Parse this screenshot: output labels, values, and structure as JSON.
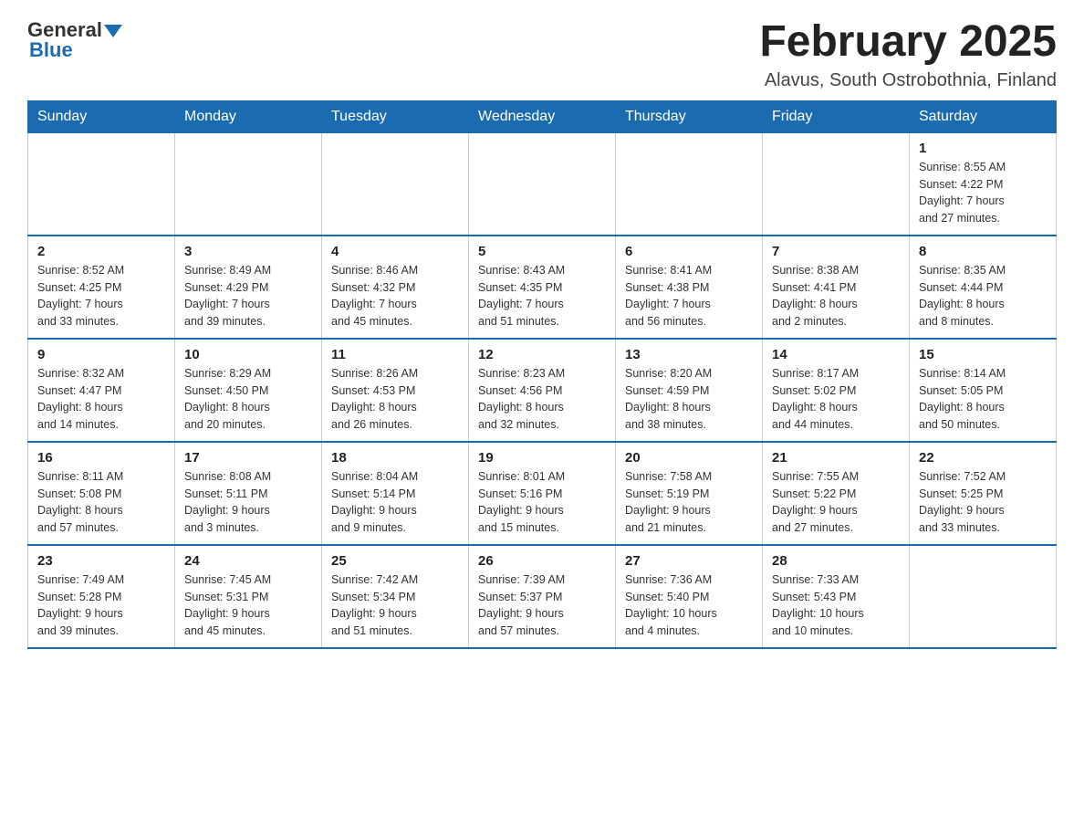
{
  "logo": {
    "text_general": "General",
    "text_blue": "Blue"
  },
  "title": "February 2025",
  "subtitle": "Alavus, South Ostrobothnia, Finland",
  "weekdays": [
    "Sunday",
    "Monday",
    "Tuesday",
    "Wednesday",
    "Thursday",
    "Friday",
    "Saturday"
  ],
  "weeks": [
    [
      {
        "day": "",
        "info": ""
      },
      {
        "day": "",
        "info": ""
      },
      {
        "day": "",
        "info": ""
      },
      {
        "day": "",
        "info": ""
      },
      {
        "day": "",
        "info": ""
      },
      {
        "day": "",
        "info": ""
      },
      {
        "day": "1",
        "info": "Sunrise: 8:55 AM\nSunset: 4:22 PM\nDaylight: 7 hours\nand 27 minutes."
      }
    ],
    [
      {
        "day": "2",
        "info": "Sunrise: 8:52 AM\nSunset: 4:25 PM\nDaylight: 7 hours\nand 33 minutes."
      },
      {
        "day": "3",
        "info": "Sunrise: 8:49 AM\nSunset: 4:29 PM\nDaylight: 7 hours\nand 39 minutes."
      },
      {
        "day": "4",
        "info": "Sunrise: 8:46 AM\nSunset: 4:32 PM\nDaylight: 7 hours\nand 45 minutes."
      },
      {
        "day": "5",
        "info": "Sunrise: 8:43 AM\nSunset: 4:35 PM\nDaylight: 7 hours\nand 51 minutes."
      },
      {
        "day": "6",
        "info": "Sunrise: 8:41 AM\nSunset: 4:38 PM\nDaylight: 7 hours\nand 56 minutes."
      },
      {
        "day": "7",
        "info": "Sunrise: 8:38 AM\nSunset: 4:41 PM\nDaylight: 8 hours\nand 2 minutes."
      },
      {
        "day": "8",
        "info": "Sunrise: 8:35 AM\nSunset: 4:44 PM\nDaylight: 8 hours\nand 8 minutes."
      }
    ],
    [
      {
        "day": "9",
        "info": "Sunrise: 8:32 AM\nSunset: 4:47 PM\nDaylight: 8 hours\nand 14 minutes."
      },
      {
        "day": "10",
        "info": "Sunrise: 8:29 AM\nSunset: 4:50 PM\nDaylight: 8 hours\nand 20 minutes."
      },
      {
        "day": "11",
        "info": "Sunrise: 8:26 AM\nSunset: 4:53 PM\nDaylight: 8 hours\nand 26 minutes."
      },
      {
        "day": "12",
        "info": "Sunrise: 8:23 AM\nSunset: 4:56 PM\nDaylight: 8 hours\nand 32 minutes."
      },
      {
        "day": "13",
        "info": "Sunrise: 8:20 AM\nSunset: 4:59 PM\nDaylight: 8 hours\nand 38 minutes."
      },
      {
        "day": "14",
        "info": "Sunrise: 8:17 AM\nSunset: 5:02 PM\nDaylight: 8 hours\nand 44 minutes."
      },
      {
        "day": "15",
        "info": "Sunrise: 8:14 AM\nSunset: 5:05 PM\nDaylight: 8 hours\nand 50 minutes."
      }
    ],
    [
      {
        "day": "16",
        "info": "Sunrise: 8:11 AM\nSunset: 5:08 PM\nDaylight: 8 hours\nand 57 minutes."
      },
      {
        "day": "17",
        "info": "Sunrise: 8:08 AM\nSunset: 5:11 PM\nDaylight: 9 hours\nand 3 minutes."
      },
      {
        "day": "18",
        "info": "Sunrise: 8:04 AM\nSunset: 5:14 PM\nDaylight: 9 hours\nand 9 minutes."
      },
      {
        "day": "19",
        "info": "Sunrise: 8:01 AM\nSunset: 5:16 PM\nDaylight: 9 hours\nand 15 minutes."
      },
      {
        "day": "20",
        "info": "Sunrise: 7:58 AM\nSunset: 5:19 PM\nDaylight: 9 hours\nand 21 minutes."
      },
      {
        "day": "21",
        "info": "Sunrise: 7:55 AM\nSunset: 5:22 PM\nDaylight: 9 hours\nand 27 minutes."
      },
      {
        "day": "22",
        "info": "Sunrise: 7:52 AM\nSunset: 5:25 PM\nDaylight: 9 hours\nand 33 minutes."
      }
    ],
    [
      {
        "day": "23",
        "info": "Sunrise: 7:49 AM\nSunset: 5:28 PM\nDaylight: 9 hours\nand 39 minutes."
      },
      {
        "day": "24",
        "info": "Sunrise: 7:45 AM\nSunset: 5:31 PM\nDaylight: 9 hours\nand 45 minutes."
      },
      {
        "day": "25",
        "info": "Sunrise: 7:42 AM\nSunset: 5:34 PM\nDaylight: 9 hours\nand 51 minutes."
      },
      {
        "day": "26",
        "info": "Sunrise: 7:39 AM\nSunset: 5:37 PM\nDaylight: 9 hours\nand 57 minutes."
      },
      {
        "day": "27",
        "info": "Sunrise: 7:36 AM\nSunset: 5:40 PM\nDaylight: 10 hours\nand 4 minutes."
      },
      {
        "day": "28",
        "info": "Sunrise: 7:33 AM\nSunset: 5:43 PM\nDaylight: 10 hours\nand 10 minutes."
      },
      {
        "day": "",
        "info": ""
      }
    ]
  ]
}
